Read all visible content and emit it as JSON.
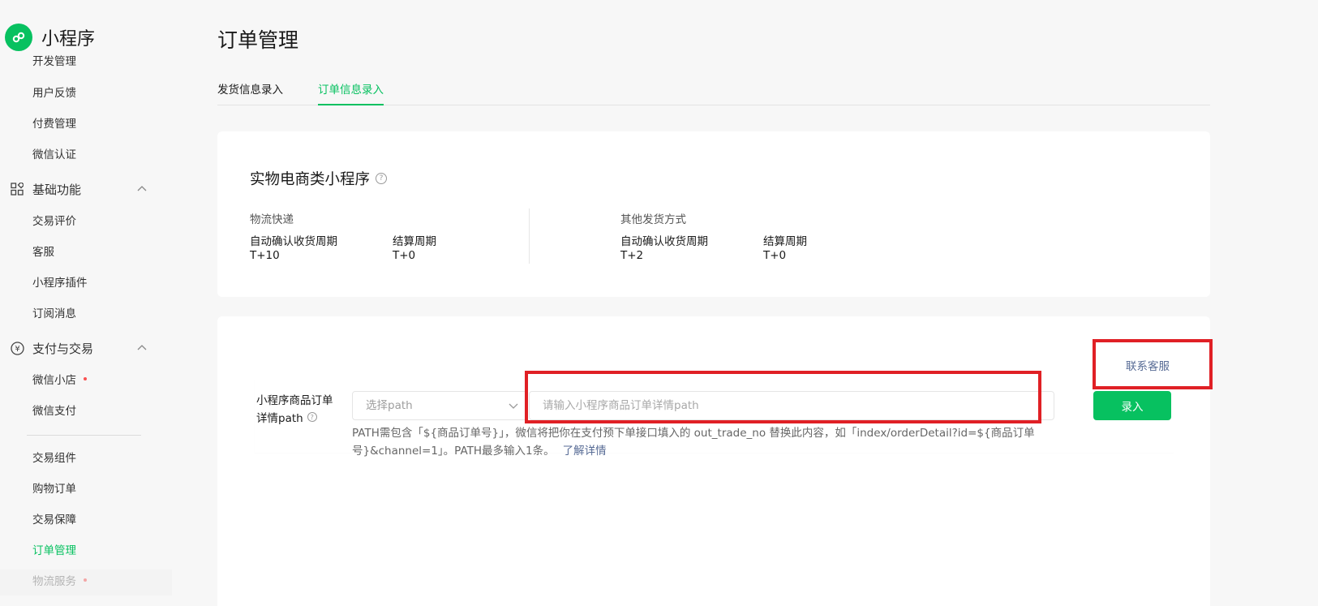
{
  "app": {
    "title": "小程序"
  },
  "sidebar": {
    "items_top": [
      "开发管理",
      "用户反馈",
      "付费管理",
      "微信认证"
    ],
    "section_basic": {
      "label": "基础功能"
    },
    "items_basic": [
      "交易评价",
      "客服",
      "小程序插件",
      "订阅消息"
    ],
    "section_pay": {
      "label": "支付与交易"
    },
    "items_pay": [
      "微信小店",
      "微信支付"
    ],
    "items_trade": [
      "交易组件",
      "购物订单",
      "交易保障",
      "订单管理",
      "物流服务"
    ],
    "active_item": "订单管理"
  },
  "main": {
    "title": "订单管理",
    "tabs": [
      "发货信息录入",
      "订单信息录入"
    ],
    "active_tab": "订单信息录入",
    "info_card": {
      "title": "实物电商类小程序",
      "groups": [
        {
          "heading": "物流快递",
          "fields": [
            {
              "label": "自动确认收货周期",
              "value": "T+10"
            },
            {
              "label": "结算周期",
              "value": "T+0"
            }
          ]
        },
        {
          "heading": "其他发货方式",
          "fields": [
            {
              "label": "自动确认收货周期",
              "value": "T+2"
            },
            {
              "label": "结算周期",
              "value": "T+0"
            }
          ]
        }
      ]
    },
    "form_card": {
      "contact_label": "联系客服",
      "field_label_line1": "小程序商品订单",
      "field_label_line2": "详情path",
      "select_placeholder": "选择path",
      "input_placeholder": "请输入小程序商品订单详情path",
      "submit_label": "录入",
      "hint_text": "PATH需包含「${商品订单号}」，微信将把你在支付预下单接口填入的 out_trade_no 替换此内容，如「index/orderDetail?id=${商品订单号}&channel=1」。PATH最多输入1条。",
      "hint_link": "了解详情"
    }
  },
  "colors": {
    "brand_green": "#07c160",
    "link_blue": "#576b95",
    "highlight_red": "#e02025",
    "notice_dot": "#fa5151"
  },
  "icons": {
    "logo": "miniprogram-logo-icon",
    "basic": "grid-icon",
    "pay": "yuan-icon",
    "help": "question-circle-icon",
    "chevron": "chevron-down-icon"
  }
}
